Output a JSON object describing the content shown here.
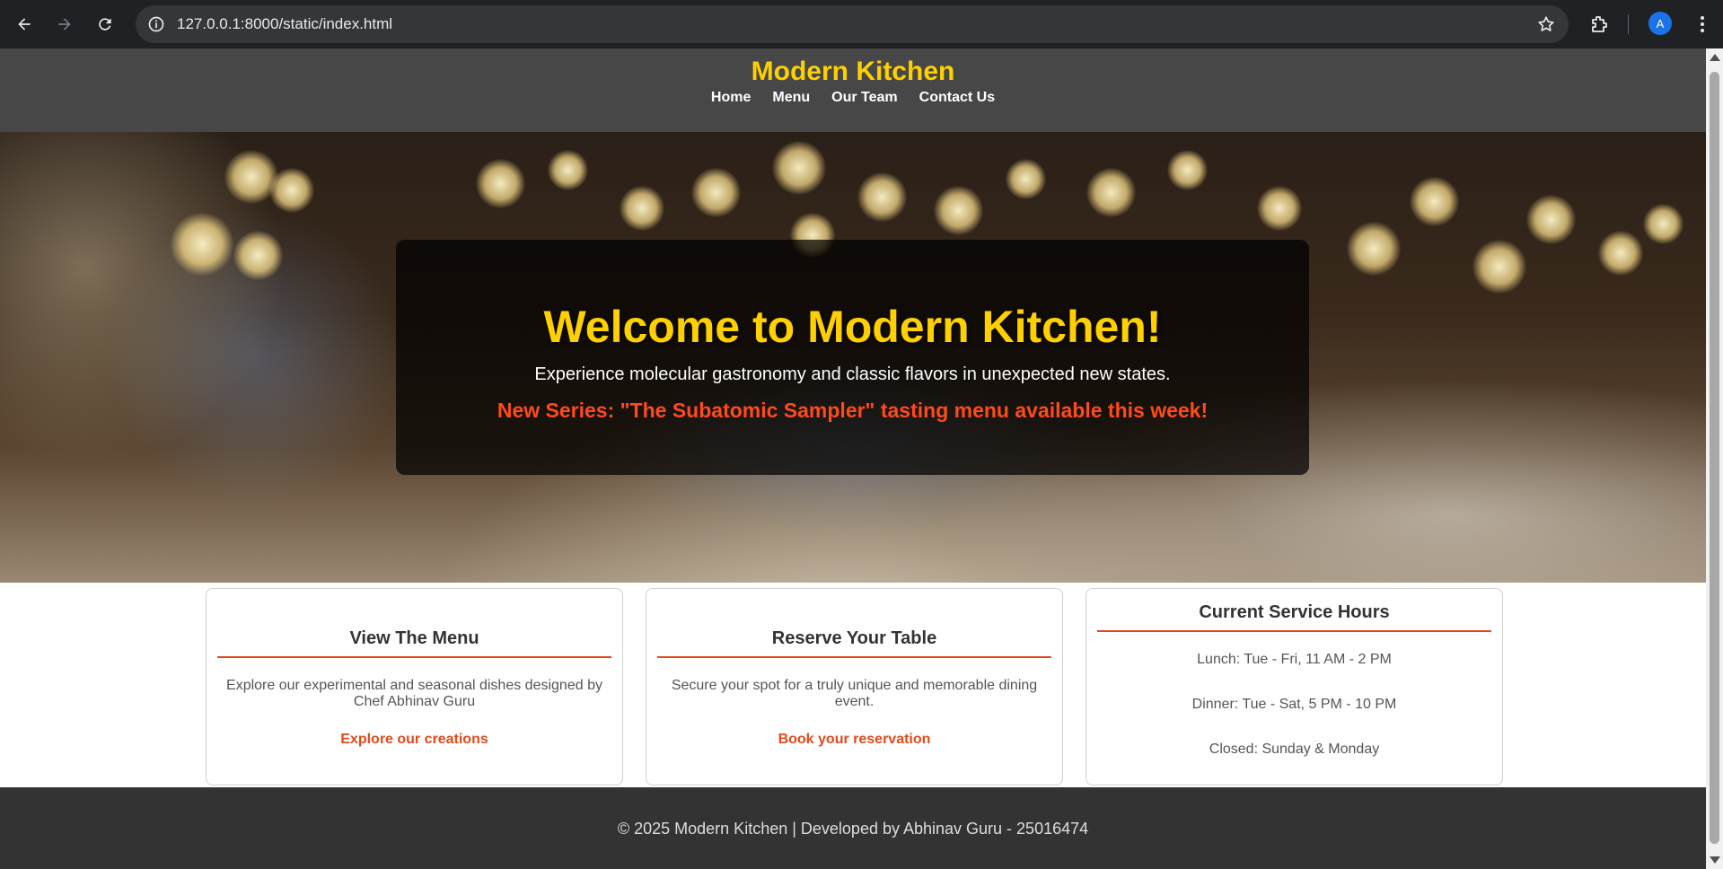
{
  "browser": {
    "url": "127.0.0.1:8000/static/index.html",
    "profile_initial": "A",
    "icons": [
      "back-icon",
      "forward-icon",
      "reload-icon",
      "info-icon",
      "star-icon",
      "extensions-icon",
      "kebab-menu-icon"
    ]
  },
  "site": {
    "title": "Modern Kitchen",
    "nav": [
      "Home",
      "Menu",
      "Our Team",
      "Contact Us"
    ]
  },
  "hero": {
    "title": "Welcome to Modern Kitchen!",
    "subtitle": "Experience molecular gastronomy and classic flavors in unexpected new states.",
    "promo": "New Series: \"The Subatomic Sampler\" tasting menu available this week!"
  },
  "cards": {
    "menu": {
      "title": "View The Menu",
      "text": "Explore our experimental and seasonal dishes designed by Chef Abhinav Guru",
      "link": "Explore our creations"
    },
    "reserve": {
      "title": "Reserve Your Table",
      "text": "Secure your spot for a truly unique and memorable dining event.",
      "link": "Book your reservation"
    },
    "hours": {
      "title": "Current Service Hours",
      "lines": [
        "Lunch: Tue - Fri, 11 AM - 2 PM",
        "Dinner: Tue - Sat, 5 PM - 10 PM",
        "Closed: Sunday & Monday"
      ]
    }
  },
  "footer": {
    "text": "© 2025 Modern Kitchen | Developed by Abhinav Guru - 25016474"
  },
  "colors": {
    "accent_yellow": "#ffd000",
    "accent_orange": "#e24a1c",
    "header_bg": "#474747",
    "footer_bg": "#333333"
  }
}
